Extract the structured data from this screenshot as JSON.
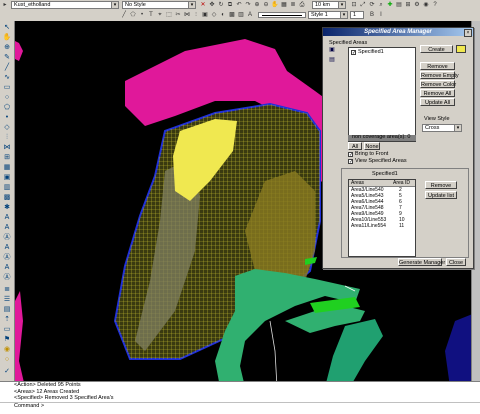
{
  "toolbar": {
    "layer_value": "Kust_etholland",
    "style_value": "No Style",
    "scale_value": "10 km",
    "linestyle_value": "Style 1",
    "num_value": "1"
  },
  "dialog": {
    "title": "Specified Area Manager",
    "specified_areas_label": "Specified Areas",
    "area_item": "Specified1",
    "create_label": "Create",
    "remove_label": "Remove",
    "remove_empty_label": "Remove Empty",
    "remove_color_label": "Remove Color",
    "remove_all_label": "Remove All",
    "update_all_label": "Update All",
    "view_style_label": "View Style",
    "view_style_value": "Cross",
    "coverage_label": "non coverage area(s): 0",
    "all_label": "All",
    "none_label": "None",
    "bring_front_label": "Bring to Front",
    "view_specified_label": "View Specified Areas",
    "specified_group_label": "Specified1",
    "col_area": "Areas",
    "col_id": "Area ID",
    "rows": [
      {
        "area": "Area3/Line540",
        "id": "2"
      },
      {
        "area": "Area5/Line543",
        "id": "5"
      },
      {
        "area": "Area6/Line544",
        "id": "6"
      },
      {
        "area": "Area7/Line548",
        "id": "7"
      },
      {
        "area": "Area9/Line549",
        "id": "9"
      },
      {
        "area": "Area10/Line553",
        "id": "10"
      },
      {
        "area": "Area11/Line554",
        "id": "11"
      }
    ],
    "remove2_label": "Remove",
    "update_list_label": "Update list",
    "generate_label": "Generate Manager",
    "close_label": "Close"
  },
  "command": {
    "lines": [
      "<Action> Deleted 95 Points",
      "<Areas> 12 Areas Created",
      "<Specified> Removed 3 Specified Area's"
    ],
    "prompt": "Command >"
  },
  "colors": {
    "magenta": "#e0189a",
    "yellow": "#f0e850",
    "grid": "#c8c030",
    "blue_outline": "#2030d8",
    "teal": "#30b070",
    "green": "#20d020",
    "navy": "#101080"
  }
}
